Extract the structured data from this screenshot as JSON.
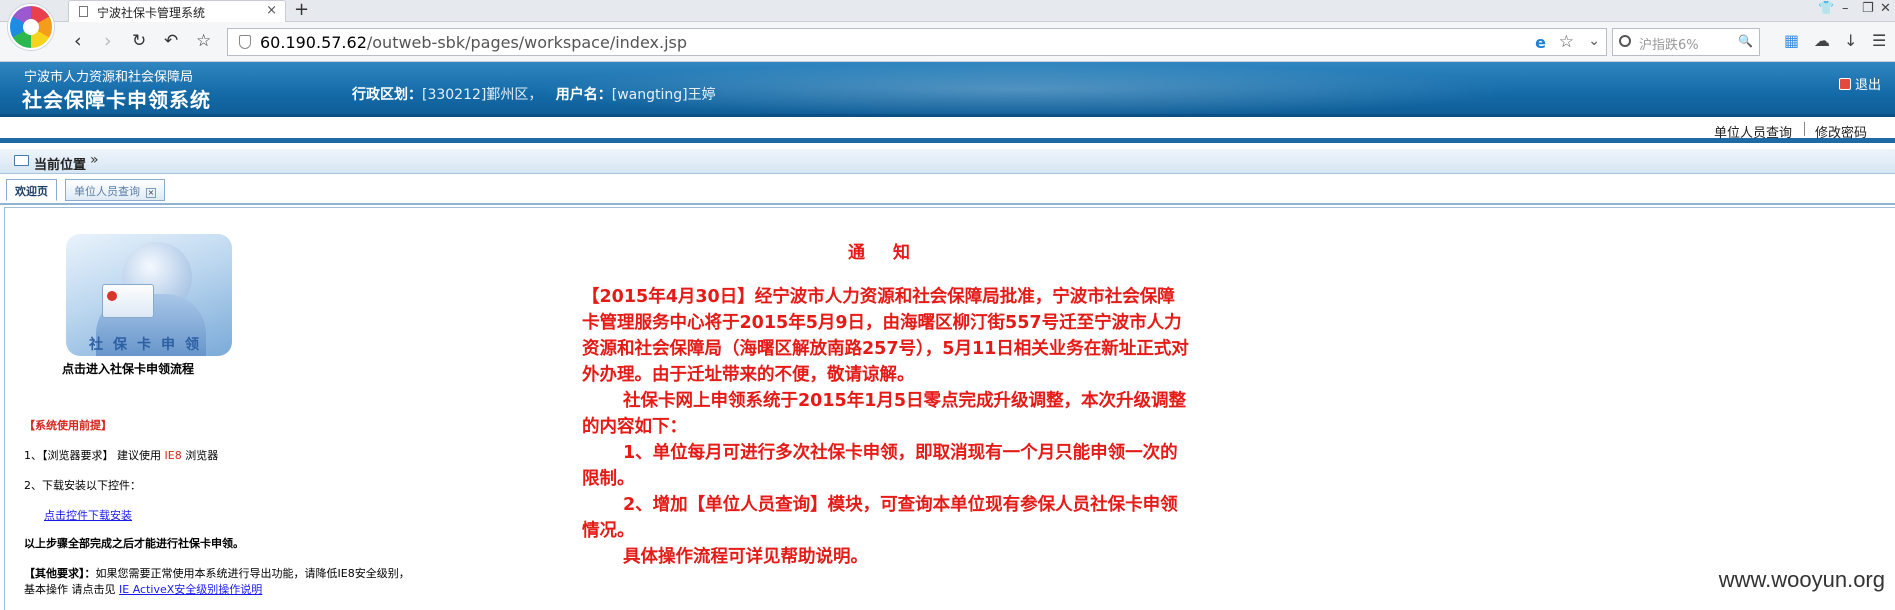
{
  "browser": {
    "tab_title": "宁波社保卡管理系统",
    "tab_close": "×",
    "new_tab": "+",
    "url_host": "60.190.57.62",
    "url_path": "/outweb-sbk/pages/workspace/index.jsp",
    "search_placeholder": "沪指跌6%"
  },
  "header": {
    "org_name": "宁波市人力资源和社会保障局",
    "system_title": "社会保障卡申领系统",
    "region_label": "行政区划：",
    "region_value": "[330212]鄞州区，",
    "user_label": "用户名：",
    "user_value": "[wangting]王婷",
    "logout_label": "退出"
  },
  "subnav": {
    "unit_query": "单位人员查询",
    "change_password": "修改密码"
  },
  "breadcrumb": {
    "label": "当前位置",
    "arrow": "»"
  },
  "page_tabs": [
    {
      "label": "欢迎页"
    },
    {
      "label": "单位人员查询"
    }
  ],
  "left_panel": {
    "card_caption": "社保卡申领",
    "card_link": "点击进入社保卡申领流程",
    "req_title": "【系统使用前提】",
    "req1_prefix": "1、【浏览器要求】 建议使用 ",
    "req1_highlight": "IE8",
    "req1_suffix": " 浏览器",
    "req2": "2、下载安装以下控件：",
    "download_link": "点击控件下载安装",
    "must_complete": "以上步骤全部完成之后才能进行社保卡申领。",
    "other_req_label": "【其他要求】：",
    "other_req_text": "如果您需要正常使用本系统进行导出功能，请降低IE8安全级别，",
    "basic_op": "基本操作  请点击见 ",
    "activex_link": "IE ActiveX安全级别操作说明"
  },
  "notice": {
    "title": "通知",
    "p1": "【2015年4月30日】经宁波市人力资源和社会保障局批准，宁波市社会保障卡管理服务中心将于2015年5月9日，由海曙区柳汀街557号迁至宁波市人力资源和社会保障局（海曙区解放南路257号），5月11日相关业务在新址正式对外办理。由于迁址带来的不便，敬请谅解。",
    "p2": "社保卡网上申领系统于2015年1月5日零点完成升级调整，本次升级调整的内容如下：",
    "p3": "1、单位每月可进行多次社保卡申领，即取消现有一个月只能申领一次的限制。",
    "p4": "2、增加【单位人员查询】模块，可查询本单位现有参保人员社保卡申领情况。",
    "p5": "具体操作流程可详见帮助说明。"
  },
  "watermark": "www.wooyun.org"
}
